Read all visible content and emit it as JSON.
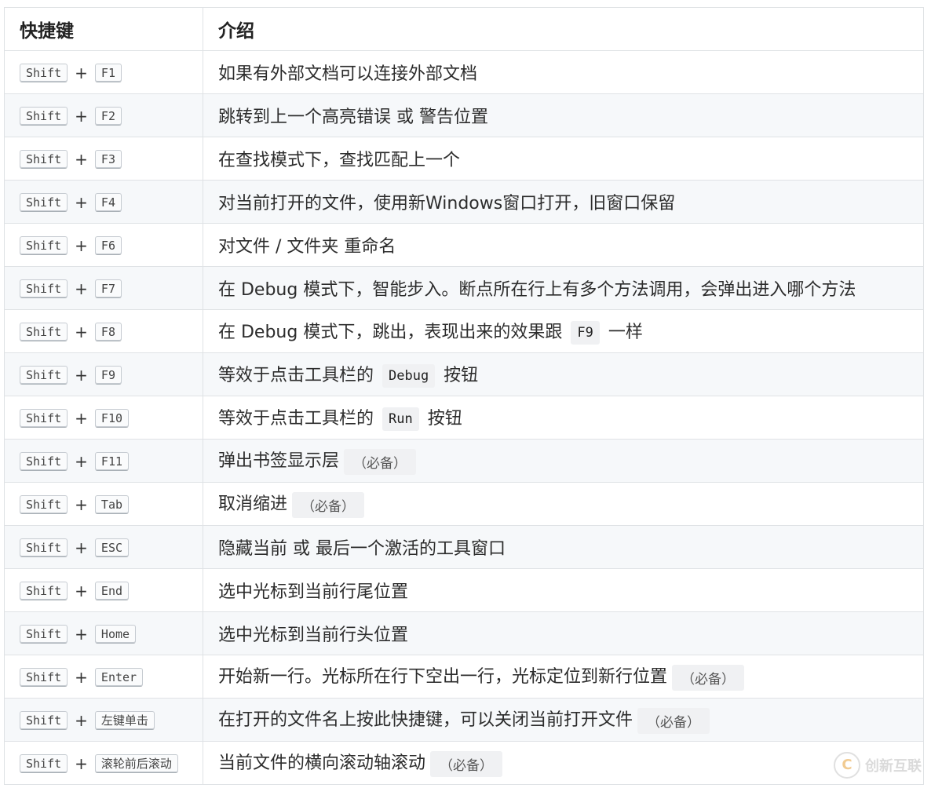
{
  "table": {
    "headers": [
      "快捷键",
      "介绍"
    ],
    "rows": [
      {
        "mod": "Shift",
        "key": "F1",
        "parts": [
          {
            "t": "text",
            "v": "如果有外部文档可以连接外部文档"
          }
        ]
      },
      {
        "mod": "Shift",
        "key": "F2",
        "parts": [
          {
            "t": "text",
            "v": "跳转到上一个高亮错误 或 警告位置"
          }
        ]
      },
      {
        "mod": "Shift",
        "key": "F3",
        "parts": [
          {
            "t": "text",
            "v": "在查找模式下，查找匹配上一个"
          }
        ]
      },
      {
        "mod": "Shift",
        "key": "F4",
        "parts": [
          {
            "t": "text",
            "v": "对当前打开的文件，使用新Windows窗口打开，旧窗口保留"
          }
        ]
      },
      {
        "mod": "Shift",
        "key": "F6",
        "parts": [
          {
            "t": "text",
            "v": "对文件 / 文件夹 重命名"
          }
        ]
      },
      {
        "mod": "Shift",
        "key": "F7",
        "parts": [
          {
            "t": "text",
            "v": "在 Debug 模式下，智能步入。断点所在行上有多个方法调用，会弹出进入哪个方法"
          }
        ]
      },
      {
        "mod": "Shift",
        "key": "F8",
        "parts": [
          {
            "t": "text",
            "v": "在 Debug 模式下，跳出，表现出来的效果跟 "
          },
          {
            "t": "code",
            "v": "F9"
          },
          {
            "t": "text",
            "v": " 一样"
          }
        ]
      },
      {
        "mod": "Shift",
        "key": "F9",
        "parts": [
          {
            "t": "text",
            "v": "等效于点击工具栏的 "
          },
          {
            "t": "code",
            "v": "Debug"
          },
          {
            "t": "text",
            "v": " 按钮"
          }
        ]
      },
      {
        "mod": "Shift",
        "key": "F10",
        "parts": [
          {
            "t": "text",
            "v": "等效于点击工具栏的 "
          },
          {
            "t": "code",
            "v": "Run"
          },
          {
            "t": "text",
            "v": " 按钮"
          }
        ]
      },
      {
        "mod": "Shift",
        "key": "F11",
        "parts": [
          {
            "t": "text",
            "v": "弹出书签显示层"
          },
          {
            "t": "note",
            "v": "（必备）"
          }
        ]
      },
      {
        "mod": "Shift",
        "key": "Tab",
        "parts": [
          {
            "t": "text",
            "v": "取消缩进"
          },
          {
            "t": "note",
            "v": "（必备）"
          }
        ]
      },
      {
        "mod": "Shift",
        "key": "ESC",
        "parts": [
          {
            "t": "text",
            "v": "隐藏当前 或 最后一个激活的工具窗口"
          }
        ]
      },
      {
        "mod": "Shift",
        "key": "End",
        "parts": [
          {
            "t": "text",
            "v": "选中光标到当前行尾位置"
          }
        ]
      },
      {
        "mod": "Shift",
        "key": "Home",
        "parts": [
          {
            "t": "text",
            "v": "选中光标到当前行头位置"
          }
        ]
      },
      {
        "mod": "Shift",
        "key": "Enter",
        "parts": [
          {
            "t": "text",
            "v": "开始新一行。光标所在行下空出一行，光标定位到新行位置"
          },
          {
            "t": "note",
            "v": "（必备）"
          }
        ]
      },
      {
        "mod": "Shift",
        "key": "左键单击",
        "parts": [
          {
            "t": "text",
            "v": "在打开的文件名上按此快捷键，可以关闭当前打开文件"
          },
          {
            "t": "note",
            "v": "（必备）"
          }
        ]
      },
      {
        "mod": "Shift",
        "key": "滚轮前后滚动",
        "parts": [
          {
            "t": "text",
            "v": "当前文件的横向滚动轴滚动"
          },
          {
            "t": "note",
            "v": "（必备）"
          }
        ]
      }
    ],
    "plus": "+"
  },
  "watermark": {
    "logo_icon": "C",
    "text": "创新互联"
  }
}
